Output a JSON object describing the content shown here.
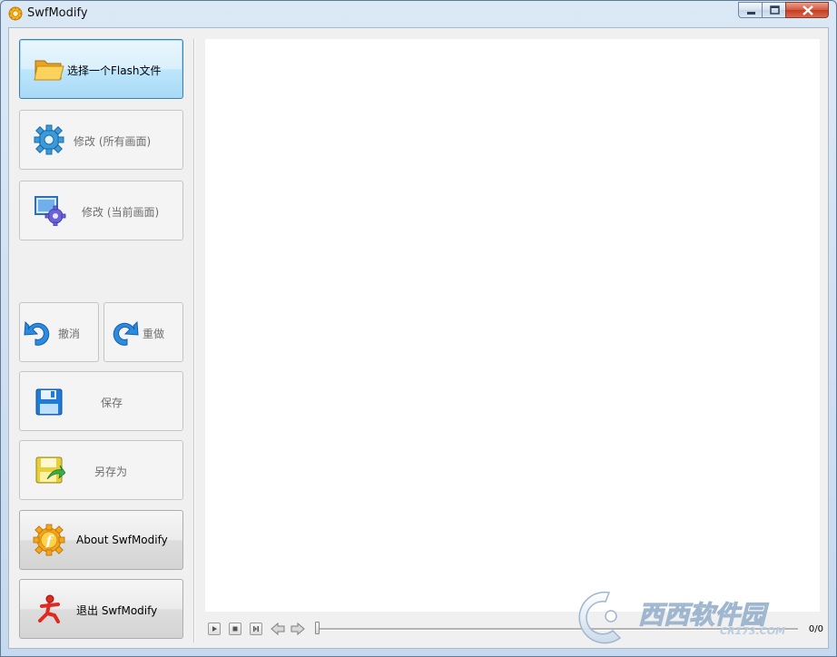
{
  "window": {
    "title": "SwfModify",
    "icon": "app-gear-icon",
    "controls": [
      "minimize-icon",
      "maximize-icon",
      "close-icon"
    ]
  },
  "sidebar": {
    "open_label": "选择一个Flash文件",
    "modify_all_label": "修改 (所有画面)",
    "modify_current_label": "修改 (当前画面)",
    "undo_label": "撤消",
    "redo_label": "重做",
    "save_label": "保存",
    "save_as_label": "另存为",
    "about_label": "About SwfModify",
    "exit_label": "退出 SwfModify"
  },
  "player": {
    "controls": [
      "play-icon",
      "stop-icon",
      "step-icon",
      "prev-frame-icon",
      "next-frame-icon"
    ],
    "frame_counter": "0/0",
    "position": 0
  },
  "watermark": {
    "text": "西西软件园",
    "subtext": "CR173.COM"
  },
  "colors": {
    "active_border": "#3c7fb1",
    "active_fill": "#bee6fd",
    "title_bar": "#dbe8f6",
    "close_button": "#c33d22"
  }
}
